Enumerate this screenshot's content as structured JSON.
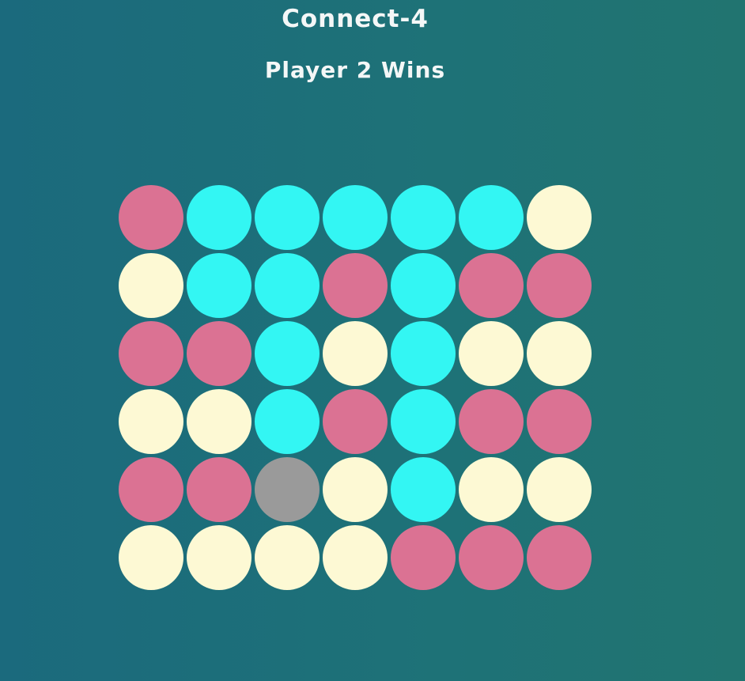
{
  "header": {
    "title": "Connect-4",
    "status": "Player 2 Wins"
  },
  "colors": {
    "player1": "#db7293",
    "player2": "#33f6f3",
    "empty": "#fdf9d4",
    "highlight": "#9a9a9a"
  },
  "board": {
    "rows": [
      [
        "player1",
        "player2",
        "player2",
        "player2",
        "player2",
        "player2",
        "empty"
      ],
      [
        "empty",
        "player2",
        "player2",
        "player1",
        "player2",
        "player1",
        "player1"
      ],
      [
        "player1",
        "player1",
        "player2",
        "empty",
        "player2",
        "empty",
        "empty"
      ],
      [
        "empty",
        "empty",
        "player2",
        "player1",
        "player2",
        "player1",
        "player1"
      ],
      [
        "player1",
        "player1",
        "highlight",
        "empty",
        "player2",
        "empty",
        "empty"
      ],
      [
        "empty",
        "empty",
        "empty",
        "empty",
        "player1",
        "player1",
        "player1"
      ]
    ]
  }
}
